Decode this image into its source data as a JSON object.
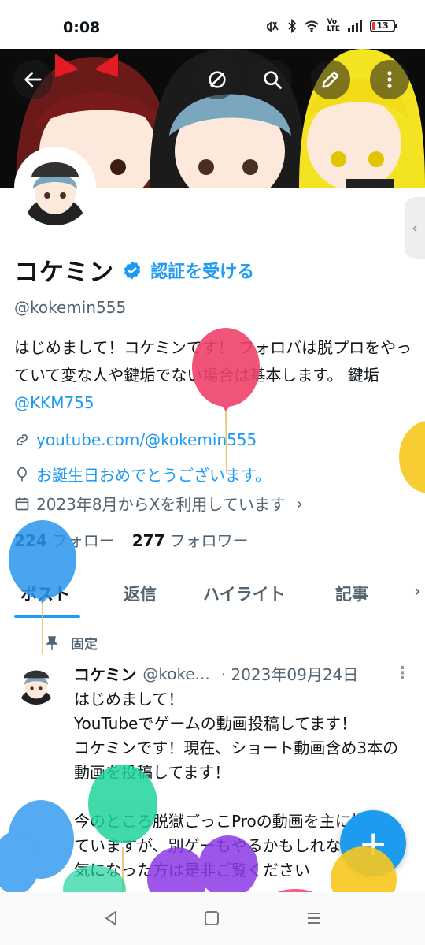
{
  "status_bar": {
    "time": "0:08",
    "battery": "13"
  },
  "header": {
    "back_icon": "arrow-left-icon",
    "grok_icon": "grok-icon",
    "search_icon": "search-icon",
    "edit_icon": "edit-icon",
    "more_icon": "more-vertical-icon"
  },
  "profile": {
    "name": "コケミン",
    "verify_cta": "認証を受ける",
    "handle": "@kokemin555",
    "bio_text": "はじめまして！コケミンです！ フォロバは脱プロをやっていて変な人や鍵垢でない場合は基本します。 鍵垢 ",
    "bio_mention": "@KKM755",
    "website": "youtube.com/@kokemin555",
    "birthday": "お誕生日おめでとうございます。",
    "joined": "2023年8月からXを利用しています",
    "following_count": "224",
    "following_label": "フォロー",
    "followers_count": "277",
    "followers_label": "フォロワー"
  },
  "tabs": [
    {
      "label": "ポスト"
    },
    {
      "label": "返信"
    },
    {
      "label": "ハイライト"
    },
    {
      "label": "記事"
    }
  ],
  "post": {
    "pinned_label": "固定",
    "name": "コケミン",
    "handle": "@koke...",
    "date": "· 2023年09月24日",
    "body": "はじめまして！\nYouTubeでゲームの動画投稿してます！\nコケミンです！現在、ショート動画含め3本の動画を投稿してます！\n\n今のところ脱獄ごっこProの動画を主に投稿していますが、別ゲーもやるかもしれないです！\n気になった方は是非ご覧ください"
  },
  "colors": {
    "accent": "#1d9bf0",
    "text": "#0f1419",
    "muted": "#536471"
  }
}
